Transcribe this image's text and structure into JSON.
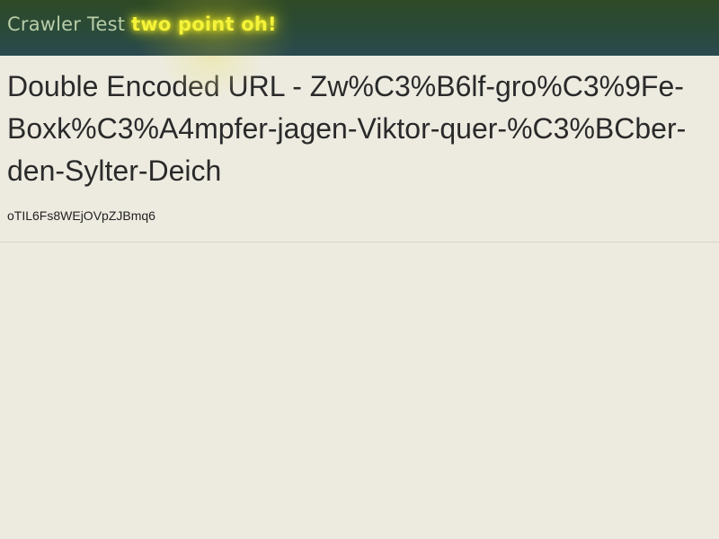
{
  "header": {
    "brand_main": "Crawler Test",
    "brand_accent": "two point oh!"
  },
  "page": {
    "title": "Double Encoded URL - Zw%C3%B6lf-gro%C3%9Fe-Boxk%C3%A4mpfer-jagen-Viktor-quer-%C3%BCber-den-Sylter-Deich",
    "code": "oTIL6Fs8WEjOVpZJBmq6"
  },
  "colors": {
    "header_bg": "#2e4a25",
    "brand_main": "#b8cda8",
    "brand_accent": "#f4f23a",
    "page_bg": "#edebe0"
  }
}
